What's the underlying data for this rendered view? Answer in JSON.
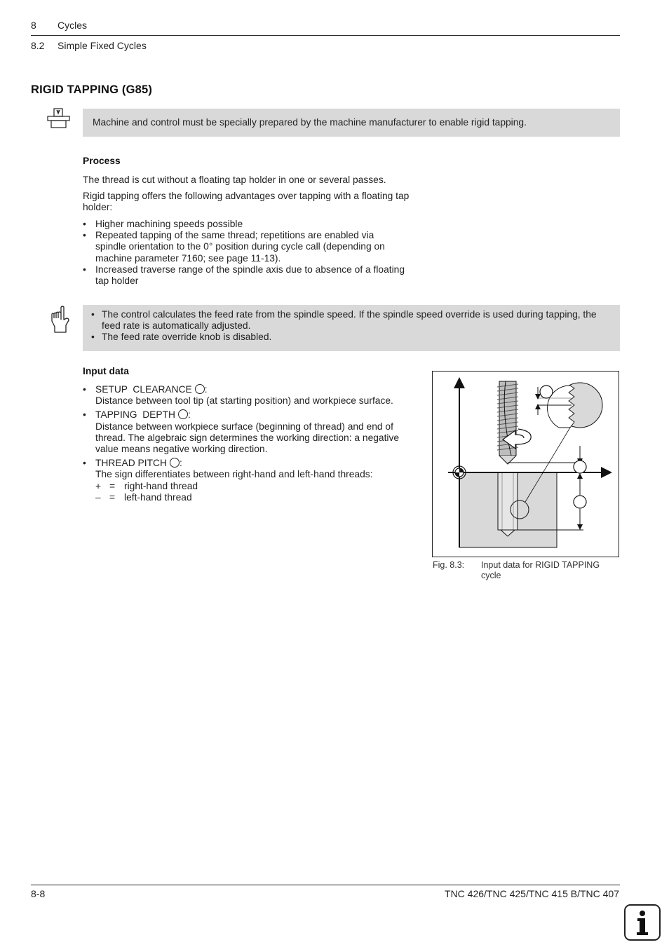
{
  "header": {
    "chapter_num": "8",
    "chapter_title": "Cycles",
    "section_num": "8.2",
    "section_title": "Simple Fixed Cycles"
  },
  "section": {
    "title": "RIGID TAPPING (G85)"
  },
  "machine_note": {
    "icon": "machine-manufacturer-icon",
    "text": "Machine and control must be specially prepared by the machine manufacturer to enable rigid tapping."
  },
  "process": {
    "heading": "Process",
    "para1": "The thread is cut without a floating tap holder in one or several passes.",
    "para2": "Rigid tapping offers the following advantages over tapping with a floating tap holder:",
    "bullets": [
      "Higher machining speeds possible",
      "Repeated tapping of the same thread; repetitions are enabled via spindle orientation to the 0° position during cycle call (depending on machine parameter 7160; see page 11-13).",
      "Increased traverse range of the spindle axis due to absence of a floating tap holder"
    ]
  },
  "hint_note": {
    "icon": "pointing-hand-icon",
    "bullets": [
      "The control calculates the feed rate from the spindle speed. If the spindle speed override is used during tapping, the feed rate is automatically adjusted.",
      "The feed rate override knob is disabled."
    ]
  },
  "input_data": {
    "heading": "Input data",
    "items": [
      {
        "label": "SETUP  CLEARANCE",
        "suffix": ":",
        "desc": "Distance between tool tip (at starting position) and workpiece surface."
      },
      {
        "label": "TAPPING  DEPTH",
        "suffix": ":",
        "desc": "Distance between workpiece surface (beginning of thread) and end of thread. The algebraic sign determines the working direction: a negative value means negative working direction."
      },
      {
        "label": "THREAD PITCH",
        "suffix": ":",
        "desc": "The sign differentiates between right-hand and left-hand threads:"
      }
    ],
    "signs": [
      {
        "sign": "+",
        "eq": "=",
        "meaning": "right-hand thread"
      },
      {
        "sign": "–",
        "eq": "=",
        "meaning": "left-hand thread"
      }
    ]
  },
  "figure": {
    "label": "Fig. 8.3:",
    "caption": "Input data for RIGID TAPPING cycle"
  },
  "footer": {
    "page": "8-8",
    "product": "TNC 426/TNC 425/TNC 415 B/TNC 407",
    "info_icon": "info-icon"
  }
}
